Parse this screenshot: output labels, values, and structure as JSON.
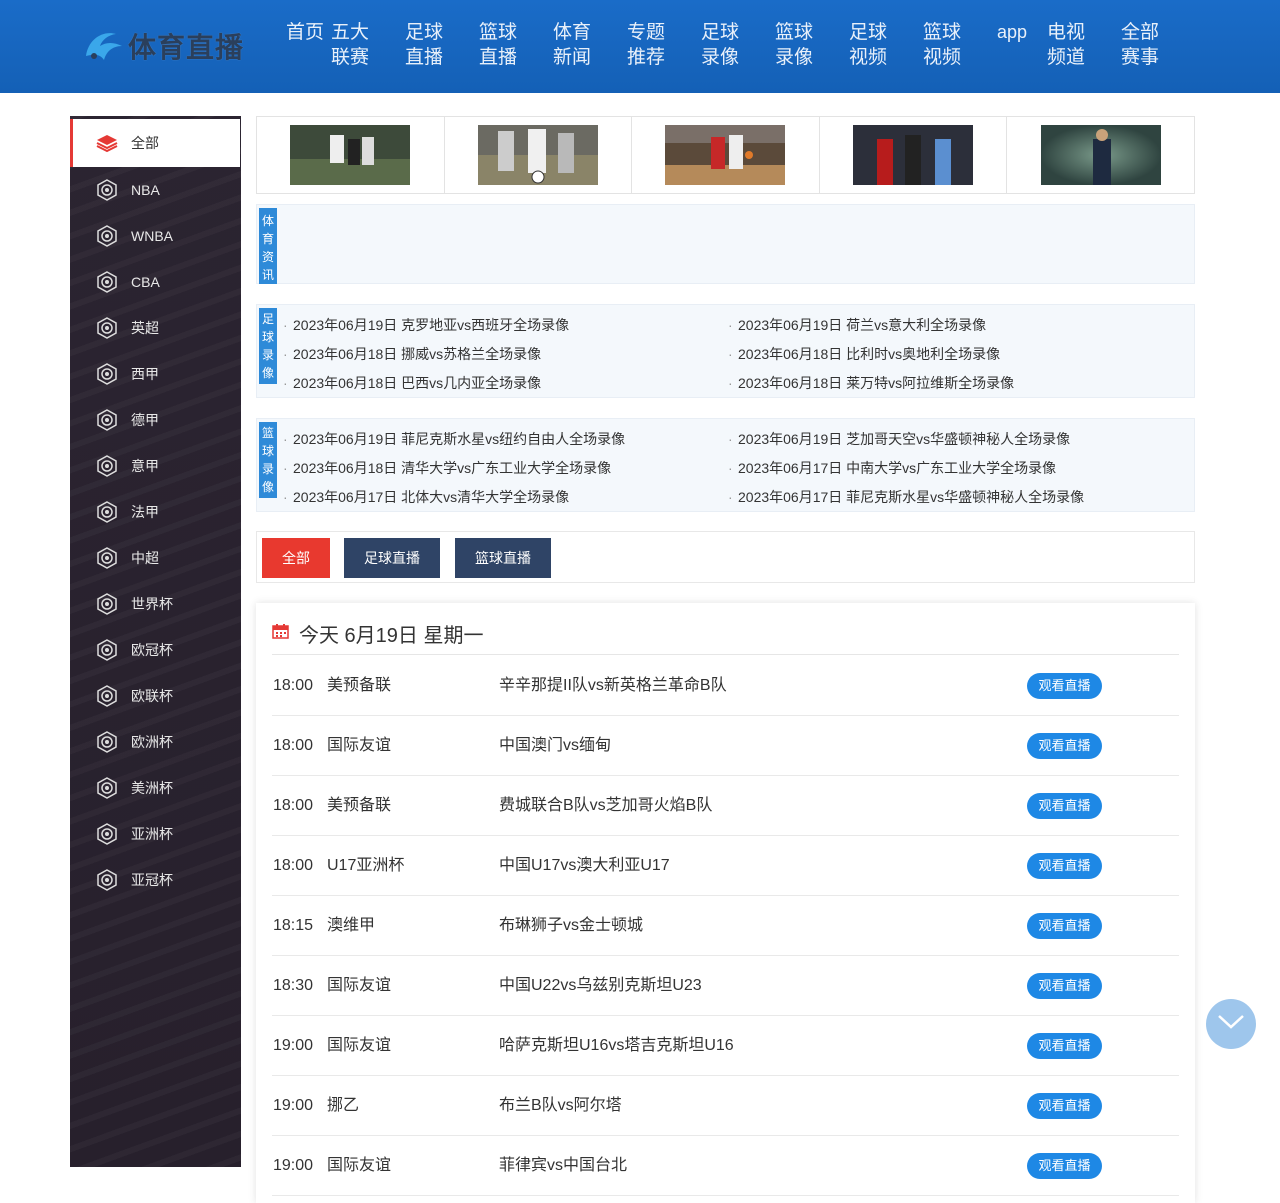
{
  "logo": {
    "text": "体育直播"
  },
  "nav": [
    {
      "label": "首页"
    },
    {
      "label": "五大联赛"
    },
    {
      "label": "足球直播"
    },
    {
      "label": "篮球直播"
    },
    {
      "label": "体育新闻"
    },
    {
      "label": "专题推荐"
    },
    {
      "label": "足球录像"
    },
    {
      "label": "篮球录像"
    },
    {
      "label": "足球视频"
    },
    {
      "label": "篮球视频"
    },
    {
      "label": "app"
    },
    {
      "label": "电视频道"
    },
    {
      "label": "全部赛事"
    }
  ],
  "sidebar": [
    {
      "label": "全部",
      "icon": "layers-icon"
    },
    {
      "label": "NBA",
      "icon": "badge-icon"
    },
    {
      "label": "WNBA",
      "icon": "badge-icon"
    },
    {
      "label": "CBA",
      "icon": "badge-icon"
    },
    {
      "label": "英超",
      "icon": "badge-icon"
    },
    {
      "label": "西甲",
      "icon": "badge-icon"
    },
    {
      "label": "德甲",
      "icon": "badge-icon"
    },
    {
      "label": "意甲",
      "icon": "badge-icon"
    },
    {
      "label": "法甲",
      "icon": "badge-icon"
    },
    {
      "label": "中超",
      "icon": "badge-icon"
    },
    {
      "label": "世界杯",
      "icon": "badge-icon"
    },
    {
      "label": "欧冠杯",
      "icon": "badge-icon"
    },
    {
      "label": "欧联杯",
      "icon": "badge-icon"
    },
    {
      "label": "欧洲杯",
      "icon": "badge-icon"
    },
    {
      "label": "美洲杯",
      "icon": "badge-icon"
    },
    {
      "label": "亚洲杯",
      "icon": "badge-icon"
    },
    {
      "label": "亚冠杯",
      "icon": "badge-icon"
    }
  ],
  "sections": {
    "news_label": "体育资讯",
    "football_label": "足球录像",
    "basketball_label": "篮球录像",
    "football": [
      "2023年06月19日 克罗地亚vs西班牙全场录像",
      "2023年06月19日 荷兰vs意大利全场录像",
      "2023年06月18日 挪威vs苏格兰全场录像",
      "2023年06月18日 比利时vs奥地利全场录像",
      "2023年06月18日 巴西vs几内亚全场录像",
      "2023年06月18日 莱万特vs阿拉维斯全场录像"
    ],
    "basketball": [
      "2023年06月19日 菲尼克斯水星vs纽约自由人全场录像",
      "2023年06月19日 芝加哥天空vs华盛顿神秘人全场录像",
      "2023年06月18日 清华大学vs广东工业大学全场录像",
      "2023年06月17日 中南大学vs广东工业大学全场录像",
      "2023年06月17日 北体大vs清华大学全场录像",
      "2023年06月17日 菲尼克斯水星vs华盛顿神秘人全场录像"
    ]
  },
  "filters": [
    {
      "label": "全部",
      "color": "#e8392f"
    },
    {
      "label": "足球直播",
      "color": "#2f4466"
    },
    {
      "label": "篮球直播",
      "color": "#2f4466"
    }
  ],
  "schedule": {
    "title": "今天 6月19日 星期一",
    "watch_label": "观看直播",
    "rows": [
      {
        "time": "18:00",
        "league": "美预备联",
        "match": "辛辛那提II队vs新英格兰革命B队"
      },
      {
        "time": "18:00",
        "league": "国际友谊",
        "match": "中国澳门vs缅甸"
      },
      {
        "time": "18:00",
        "league": "美预备联",
        "match": "费城联合B队vs芝加哥火焰B队"
      },
      {
        "time": "18:00",
        "league": "U17亚洲杯",
        "match": "中国U17vs澳大利亚U17"
      },
      {
        "time": "18:15",
        "league": "澳维甲",
        "match": "布琳狮子vs金士顿城"
      },
      {
        "time": "18:30",
        "league": "国际友谊",
        "match": "中国U22vs乌兹别克斯坦U23"
      },
      {
        "time": "19:00",
        "league": "国际友谊",
        "match": "哈萨克斯坦U16vs塔吉克斯坦U16"
      },
      {
        "time": "19:00",
        "league": "挪乙",
        "match": "布兰B队vs阿尔塔"
      },
      {
        "time": "19:00",
        "league": "国际友谊",
        "match": "菲律宾vs中国台北"
      }
    ]
  },
  "colors": {
    "header": "#1565c0",
    "sidebar": "#2a2230",
    "accent_red": "#e53935",
    "watch_button": "#1e88e5"
  }
}
